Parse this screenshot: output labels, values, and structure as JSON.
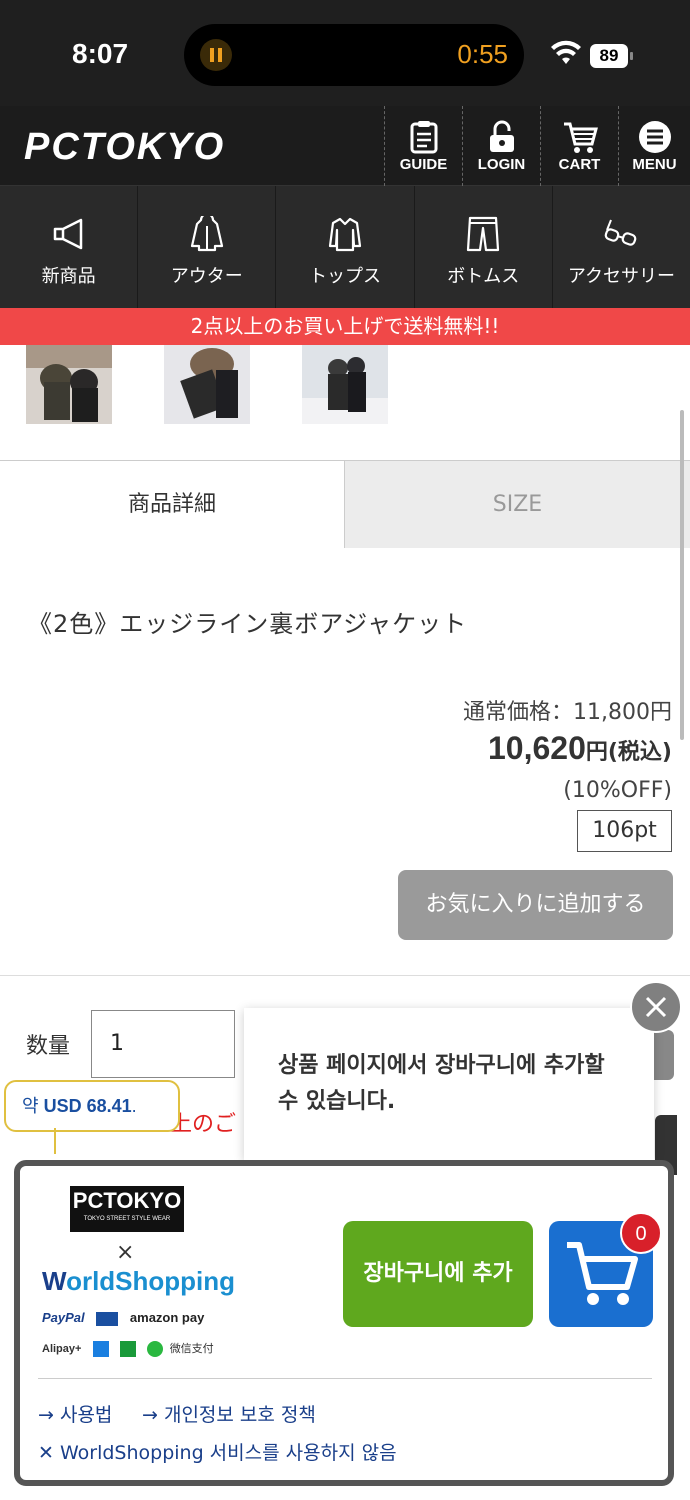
{
  "status_bar": {
    "time": "8:07",
    "recording_time": "0:55",
    "battery": "89"
  },
  "header": {
    "logo": "PCTOKYO",
    "buttons": [
      {
        "label": "GUIDE",
        "icon": "guide-icon"
      },
      {
        "label": "LOGIN",
        "icon": "lock-icon"
      },
      {
        "label": "CART",
        "icon": "cart-icon"
      },
      {
        "label": "MENU",
        "icon": "menu-icon"
      }
    ]
  },
  "categories": [
    {
      "label": "新商品",
      "icon": "megaphone-icon"
    },
    {
      "label": "アウター",
      "icon": "jacket-icon"
    },
    {
      "label": "トップス",
      "icon": "shirt-icon"
    },
    {
      "label": "ボトムス",
      "icon": "pants-icon"
    },
    {
      "label": "アクセサリー",
      "icon": "glasses-icon"
    }
  ],
  "banner": "2点以上のお買い上げで送料無料!!",
  "tabs": {
    "detail": "商品詳細",
    "size": "SIZE"
  },
  "product": {
    "title": "《2色》エッジライン裏ボアジャケット",
    "regular_price": "通常価格：11,800円",
    "price": "10,620",
    "price_unit": "円(税込)",
    "discount": "(10%OFF)",
    "points_value": "106",
    "points_unit": "pt",
    "favorite_button": "お気に入りに追加する"
  },
  "quantity": {
    "label": "数量",
    "value": "1"
  },
  "partial_notice": "上のご",
  "usd_bubble": {
    "prefix": "약",
    "amount": "USD 68.41",
    "suffix": "."
  },
  "tooltip": {
    "text": "상품 페이지에서 장바구니에 추가할 수 있습니다."
  },
  "worldshopping": {
    "pc_logo": "PCTOKYO",
    "pc_logo_sub": "TOKYO STREET STYLE WEAR",
    "times": "×",
    "ws_logo_w": "W",
    "ws_logo_rest": "orldShopping",
    "payments_row1": [
      "PayPal",
      "amazon pay"
    ],
    "payments_row2": [
      "Alipay+",
      "微信支付"
    ],
    "add_to_cart": "장바구니에 추가",
    "cart_count": "0",
    "links": {
      "how_to": "→ 사용법",
      "privacy": "→ 개인정보 보호 정책",
      "disable": "✕ WorldShopping 서비스를 사용하지 않음"
    }
  },
  "colors": {
    "banner": "#f04848",
    "add_to_cart": "#5fa81e",
    "cart_button": "#1a6fd0",
    "badge": "#d8202a",
    "link": "#1a3f8a"
  }
}
